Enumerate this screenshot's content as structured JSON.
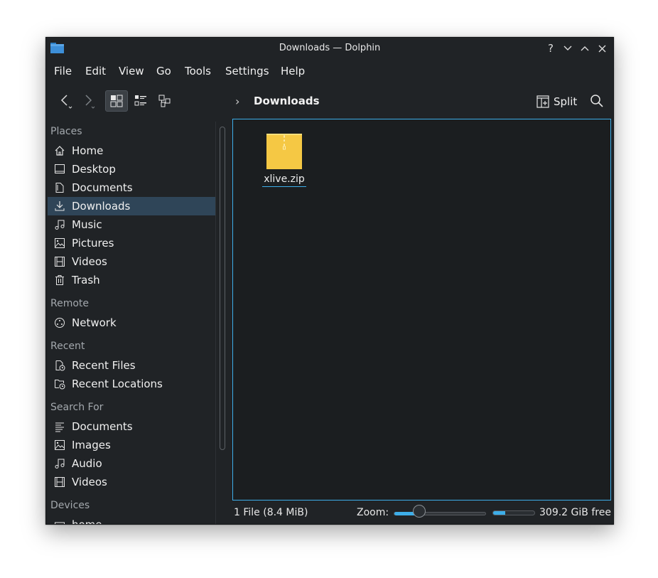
{
  "window": {
    "title": "Downloads — Dolphin",
    "controls": {
      "help": "?",
      "minimize": "chevron-down-icon",
      "maximize": "chevron-up-icon",
      "close": "close-icon"
    }
  },
  "menu": [
    "File",
    "Edit",
    "View",
    "Go",
    "Tools",
    "Settings",
    "Help"
  ],
  "toolbar": {
    "breadcrumb_current": "Downloads",
    "split_label": "Split"
  },
  "sidebar": {
    "sections": [
      {
        "label": "Places",
        "items": [
          {
            "label": "Home",
            "icon": "home-icon"
          },
          {
            "label": "Desktop",
            "icon": "desktop-icon"
          },
          {
            "label": "Documents",
            "icon": "documents-icon"
          },
          {
            "label": "Downloads",
            "icon": "download-icon",
            "selected": true
          },
          {
            "label": "Music",
            "icon": "music-icon"
          },
          {
            "label": "Pictures",
            "icon": "pictures-icon"
          },
          {
            "label": "Videos",
            "icon": "videos-icon"
          },
          {
            "label": "Trash",
            "icon": "trash-icon"
          }
        ]
      },
      {
        "label": "Remote",
        "items": [
          {
            "label": "Network",
            "icon": "network-icon"
          }
        ]
      },
      {
        "label": "Recent",
        "items": [
          {
            "label": "Recent Files",
            "icon": "recent-files-icon"
          },
          {
            "label": "Recent Locations",
            "icon": "recent-locations-icon"
          }
        ]
      },
      {
        "label": "Search For",
        "items": [
          {
            "label": "Documents",
            "icon": "documents-search-icon"
          },
          {
            "label": "Images",
            "icon": "images-icon"
          },
          {
            "label": "Audio",
            "icon": "audio-icon"
          },
          {
            "label": "Videos",
            "icon": "videos-icon"
          }
        ]
      },
      {
        "label": "Devices",
        "items": [
          {
            "label": "home",
            "icon": "drive-icon"
          }
        ]
      }
    ]
  },
  "files": [
    {
      "name": "xlive.zip",
      "icon": "zip-archive-icon"
    }
  ],
  "statusbar": {
    "summary": "1 File (8.4 MiB)",
    "zoom_label": "Zoom:",
    "zoom_fraction": 0.28,
    "free_space": "309.2 GiB free",
    "used_fraction": 0.3
  },
  "colors": {
    "accent": "#3daee9",
    "window_bg": "#202326",
    "view_bg": "#1b1e20",
    "selection": "#2f4558"
  }
}
